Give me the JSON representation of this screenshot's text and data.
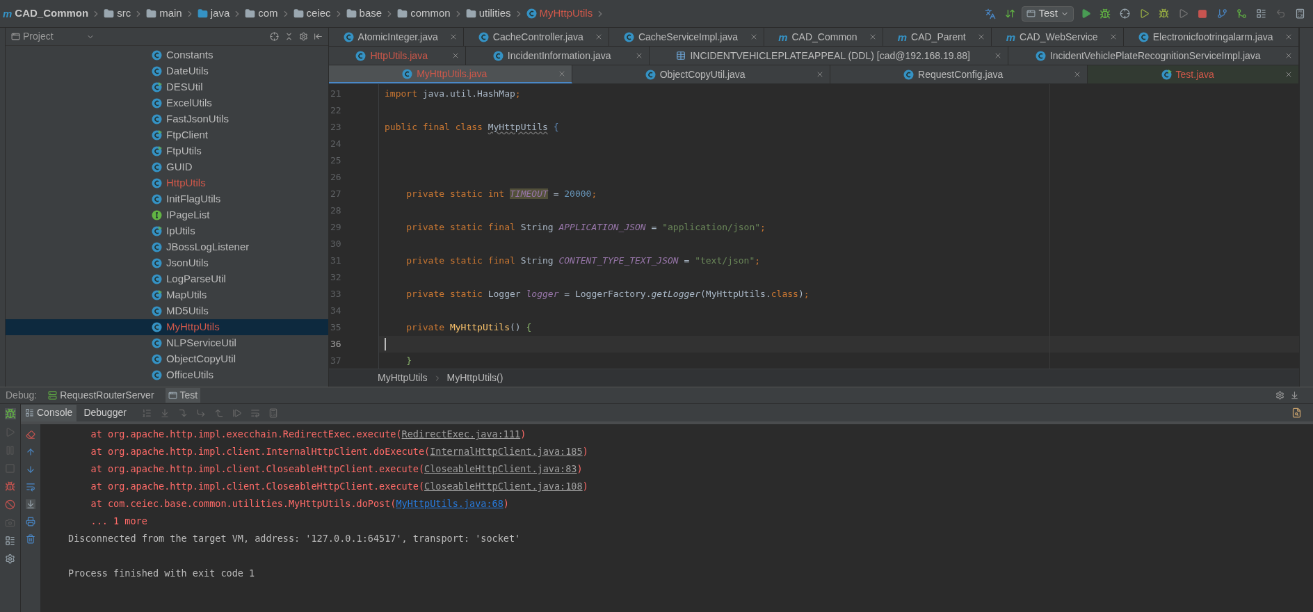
{
  "nav_bar": {
    "crumbs": [
      {
        "label": "CAD_Common",
        "kind": "module",
        "glyph": "m",
        "modified": false
      },
      {
        "label": "src",
        "kind": "folder",
        "modified": false
      },
      {
        "label": "main",
        "kind": "folder",
        "modified": false
      },
      {
        "label": "java",
        "kind": "source-folder",
        "modified": false
      },
      {
        "label": "com",
        "kind": "package",
        "modified": false
      },
      {
        "label": "ceiec",
        "kind": "package",
        "modified": false
      },
      {
        "label": "base",
        "kind": "package",
        "modified": false
      },
      {
        "label": "common",
        "kind": "package",
        "modified": false
      },
      {
        "label": "utilities",
        "kind": "package",
        "modified": false
      },
      {
        "label": "MyHttpUtils",
        "kind": "class",
        "modified": true
      }
    ],
    "run_config": "Test"
  },
  "project_panel": {
    "title": "Project",
    "items": [
      {
        "name": "Constants",
        "kind": "class",
        "modified": false,
        "selected": false
      },
      {
        "name": "DateUtils",
        "kind": "class",
        "modified": false,
        "selected": false
      },
      {
        "name": "DESUtil",
        "kind": "runnable",
        "modified": false,
        "selected": false
      },
      {
        "name": "ExcelUtils",
        "kind": "class",
        "modified": false,
        "selected": false
      },
      {
        "name": "FastJsonUtils",
        "kind": "class",
        "modified": false,
        "selected": false
      },
      {
        "name": "FtpClient",
        "kind": "runnable",
        "modified": false,
        "selected": false
      },
      {
        "name": "FtpUtils",
        "kind": "runnable",
        "modified": false,
        "selected": false
      },
      {
        "name": "GUID",
        "kind": "class",
        "modified": false,
        "selected": false
      },
      {
        "name": "HttpUtils",
        "kind": "class",
        "modified": true,
        "selected": false
      },
      {
        "name": "InitFlagUtils",
        "kind": "class",
        "modified": false,
        "selected": false
      },
      {
        "name": "IPageList",
        "kind": "interface",
        "modified": false,
        "selected": false
      },
      {
        "name": "IpUtils",
        "kind": "runnable",
        "modified": false,
        "selected": false
      },
      {
        "name": "JBossLogListener",
        "kind": "class",
        "modified": false,
        "selected": false
      },
      {
        "name": "JsonUtils",
        "kind": "class",
        "modified": false,
        "selected": false
      },
      {
        "name": "LogParseUtil",
        "kind": "class",
        "modified": false,
        "selected": false
      },
      {
        "name": "MapUtils",
        "kind": "runnable",
        "modified": false,
        "selected": false
      },
      {
        "name": "MD5Utils",
        "kind": "class",
        "modified": false,
        "selected": false
      },
      {
        "name": "MyHttpUtils",
        "kind": "class",
        "modified": true,
        "selected": true
      },
      {
        "name": "NLPServiceUtil",
        "kind": "class",
        "modified": false,
        "selected": false
      },
      {
        "name": "ObjectCopyUtil",
        "kind": "class",
        "modified": false,
        "selected": false
      },
      {
        "name": "OfficeUtils",
        "kind": "class",
        "modified": false,
        "selected": false
      }
    ]
  },
  "editor_tabs": [
    [
      {
        "label": "AtomicInteger.java",
        "kind": "class",
        "modified": false,
        "selected": false
      },
      {
        "label": "CacheController.java",
        "kind": "class",
        "modified": false,
        "selected": false
      },
      {
        "label": "CacheServiceImpl.java",
        "kind": "class",
        "modified": false,
        "selected": false
      },
      {
        "label": "CAD_Common",
        "kind": "module",
        "glyph": "m",
        "modified": false,
        "selected": false
      },
      {
        "label": "CAD_Parent",
        "kind": "module",
        "glyph": "m",
        "modified": false,
        "selected": false
      },
      {
        "label": "CAD_WebService",
        "kind": "module",
        "glyph": "m",
        "modified": false,
        "selected": false
      },
      {
        "label": "Electronicfootringalarm.java",
        "kind": "class",
        "modified": false,
        "selected": false
      }
    ],
    [
      {
        "label": "HttpUtils.java",
        "kind": "class",
        "modified": true,
        "selected": false
      },
      {
        "label": "IncidentInformation.java",
        "kind": "class",
        "modified": false,
        "selected": false
      },
      {
        "label": "INCIDENTVEHICLEPLATEAPPEAL (DDL) [cad@192.168.19.88]",
        "kind": "table",
        "modified": false,
        "selected": false
      },
      {
        "label": "IncidentVehiclePlateRecognitionServiceImpl.java",
        "kind": "class",
        "modified": false,
        "selected": false
      }
    ],
    [
      {
        "label": "MyHttpUtils.java",
        "kind": "class",
        "modified": true,
        "selected": true
      },
      {
        "label": "ObjectCopyUtil.java",
        "kind": "class",
        "modified": false,
        "selected": false
      },
      {
        "label": "RequestConfig.java",
        "kind": "class",
        "modified": false,
        "selected": false
      },
      {
        "label": "Test.java",
        "kind": "runnable",
        "modified": true,
        "selected": false
      }
    ]
  ],
  "code": [
    {
      "number": "21",
      "current": false,
      "indent": false,
      "segments": [
        {
          "kind": "keyword",
          "text": "import "
        },
        {
          "kind": "text",
          "text": "java.util.HashMap"
        },
        {
          "kind": "keyword",
          "text": ";"
        }
      ]
    },
    {
      "number": "22",
      "current": false
    },
    {
      "number": "23",
      "current": false,
      "indent": false,
      "segments": [
        {
          "kind": "keyword",
          "text": "public final class "
        },
        {
          "kind": "class-name",
          "text": "MyHttpUtils"
        },
        {
          "kind": "brace",
          "text": " {"
        }
      ]
    },
    {
      "number": "24",
      "current": false
    },
    {
      "number": "25",
      "current": false
    },
    {
      "number": "26",
      "current": false
    },
    {
      "number": "27",
      "current": false,
      "indent": true,
      "segments": [
        {
          "kind": "keyword",
          "text": "private static int "
        },
        {
          "kind": "highlighted-field",
          "text": "TIMEOUT"
        },
        {
          "kind": "text",
          "text": " = "
        },
        {
          "kind": "number",
          "text": "20000"
        },
        {
          "kind": "keyword",
          "text": ";"
        }
      ]
    },
    {
      "number": "28",
      "current": false
    },
    {
      "number": "29",
      "current": false,
      "indent": true,
      "segments": [
        {
          "kind": "keyword",
          "text": "private static final "
        },
        {
          "kind": "text",
          "text": "String "
        },
        {
          "kind": "field",
          "text": "APPLICATION_JSON"
        },
        {
          "kind": "text",
          "text": " = "
        },
        {
          "kind": "string",
          "text": "\"application/json\""
        },
        {
          "kind": "keyword",
          "text": ";"
        }
      ]
    },
    {
      "number": "30",
      "current": false
    },
    {
      "number": "31",
      "current": false,
      "indent": true,
      "segments": [
        {
          "kind": "keyword",
          "text": "private static final "
        },
        {
          "kind": "text",
          "text": "String "
        },
        {
          "kind": "field",
          "text": "CONTENT_TYPE_TEXT_JSON"
        },
        {
          "kind": "text",
          "text": " = "
        },
        {
          "kind": "string",
          "text": "\"text/json\""
        },
        {
          "kind": "keyword",
          "text": ";"
        }
      ]
    },
    {
      "number": "32",
      "current": false
    },
    {
      "number": "33",
      "current": false,
      "indent": true,
      "segments": [
        {
          "kind": "keyword",
          "text": "private static "
        },
        {
          "kind": "text",
          "text": "Logger "
        },
        {
          "kind": "field",
          "text": "logger"
        },
        {
          "kind": "text",
          "text": " = LoggerFactory."
        },
        {
          "kind": "static-call",
          "text": "getLogger"
        },
        {
          "kind": "text",
          "text": "(MyHttpUtils."
        },
        {
          "kind": "keyword",
          "text": "class"
        },
        {
          "kind": "text",
          "text": ")"
        },
        {
          "kind": "keyword",
          "text": ";"
        }
      ]
    },
    {
      "number": "34",
      "current": false
    },
    {
      "number": "35",
      "current": false,
      "indent": true,
      "segments": [
        {
          "kind": "keyword",
          "text": "private "
        },
        {
          "kind": "declaration",
          "text": "MyHttpUtils"
        },
        {
          "kind": "text",
          "text": "() "
        },
        {
          "kind": "method-brace",
          "text": "{"
        }
      ]
    },
    {
      "number": "36",
      "current": true
    },
    {
      "number": "37",
      "current": false,
      "indent": true,
      "segments": [
        {
          "kind": "method-brace",
          "text": "}"
        }
      ]
    }
  ],
  "editor_breadcrumb": [
    "MyHttpUtils",
    "MyHttpUtils()"
  ],
  "debug_panel": {
    "title": "Debug:",
    "sessions": [
      {
        "label": "RequestRouterServer",
        "kind": "server",
        "selected": false
      },
      {
        "label": "Test",
        "kind": "app",
        "selected": true
      }
    ],
    "tabs": [
      {
        "label": "Console",
        "selected": true
      },
      {
        "label": "Debugger",
        "selected": false
      }
    ],
    "console": [
      {
        "kind": "error",
        "text": "    at org.apache.http.impl.execchain.RedirectExec.execute(",
        "link": "RedirectExec.java:111",
        "in_project": false,
        "after": ")"
      },
      {
        "kind": "error",
        "text": "    at org.apache.http.impl.client.InternalHttpClient.doExecute(",
        "link": "InternalHttpClient.java:185",
        "in_project": false,
        "after": ")"
      },
      {
        "kind": "error",
        "text": "    at org.apache.http.impl.client.CloseableHttpClient.execute(",
        "link": "CloseableHttpClient.java:83",
        "in_project": false,
        "after": ")"
      },
      {
        "kind": "error",
        "text": "    at org.apache.http.impl.client.CloseableHttpClient.execute(",
        "link": "CloseableHttpClient.java:108",
        "in_project": false,
        "after": ")"
      },
      {
        "kind": "error",
        "text": "    at com.ceiec.base.common.utilities.MyHttpUtils.doPost(",
        "link": "MyHttpUtils.java:68",
        "in_project": true,
        "after": ")"
      },
      {
        "kind": "error",
        "text": "    ... 1 more"
      },
      {
        "kind": "info",
        "text": "Disconnected from the target VM, address: '127.0.0.1:64517', transport: 'socket'"
      },
      {
        "kind": "blank"
      },
      {
        "kind": "info",
        "text": "Process finished with exit code 1"
      }
    ]
  }
}
